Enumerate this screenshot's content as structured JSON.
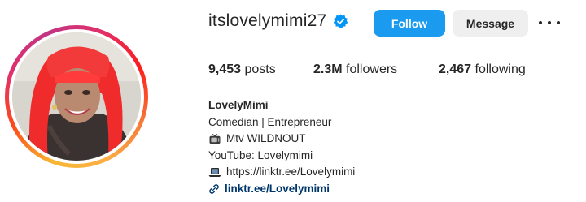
{
  "profile": {
    "username": "itslovelymimi27",
    "verified": true,
    "verified_icon": "verified-badge-icon",
    "avatar_icon": "profile-photo"
  },
  "actions": {
    "follow_label": "Follow",
    "message_label": "Message",
    "more_icon": "more-options-icon"
  },
  "stats": {
    "posts_count": "9,453",
    "posts_label": "posts",
    "followers_count": "2.3M",
    "followers_label": "followers",
    "following_count": "2,467",
    "following_label": "following"
  },
  "bio": {
    "display_name": "LovelyMimi",
    "category": "Comedian | Entrepreneur",
    "line_tv": "Mtv WILDNOUT",
    "line_tv_icon": "tv-icon",
    "line_youtube": "YouTube: Lovelymimi",
    "line_laptop": "https://linktr.ee/Lovelymimi",
    "line_laptop_icon": "laptop-icon",
    "link_text": "linktr.ee/Lovelymimi",
    "link_icon": "link-icon"
  },
  "colors": {
    "follow_button": "#1a9bf0",
    "message_button": "#efefef",
    "link": "#00376b",
    "verified": "#0095f6"
  }
}
